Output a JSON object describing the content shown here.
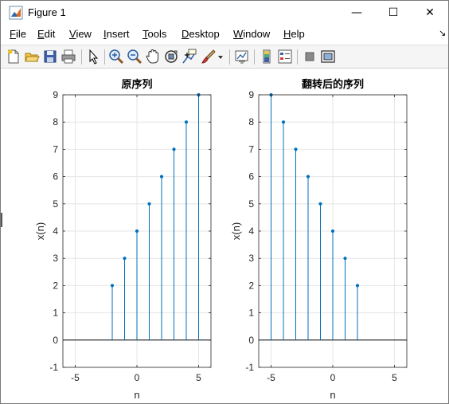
{
  "window": {
    "title": "Figure 1",
    "min_symbol": "—",
    "max_symbol": "☐",
    "close_symbol": "✕"
  },
  "menubar": {
    "items": [
      {
        "label": "File",
        "accel": "F",
        "rest": "ile"
      },
      {
        "label": "Edit",
        "accel": "E",
        "rest": "dit"
      },
      {
        "label": "View",
        "accel": "V",
        "rest": "iew"
      },
      {
        "label": "Insert",
        "accel": "I",
        "rest": "nsert"
      },
      {
        "label": "Tools",
        "accel": "T",
        "rest": "ools"
      },
      {
        "label": "Desktop",
        "accel": "D",
        "rest": "esktop"
      },
      {
        "label": "Window",
        "accel": "W",
        "rest": "indow"
      },
      {
        "label": "Help",
        "accel": "H",
        "rest": "elp"
      }
    ],
    "overflow_arrow": "↘"
  },
  "toolbar": {
    "icons": [
      "new-figure-icon",
      "open-file-icon",
      "save-icon",
      "print-icon",
      "edit-plot-arrow-icon",
      "zoom-in-icon",
      "zoom-out-icon",
      "pan-hand-icon",
      "rotate-3d-icon",
      "data-cursor-icon",
      "brush-icon",
      "brush-dropdown-icon",
      "link-plot-icon",
      "colorbar-icon",
      "legend-icon",
      "hide-plot-tools-icon",
      "show-plot-tools-icon"
    ]
  },
  "colors": {
    "stem": "#0072BD",
    "axis": "#262626",
    "grid": "#e6e6e6",
    "zero_line": "#000000"
  },
  "chart_data": [
    {
      "type": "stem",
      "title": "原序列",
      "xlabel": "n",
      "ylabel": "x(n)",
      "xlim": [
        -6,
        6
      ],
      "ylim": [
        -1,
        9
      ],
      "xticks": [
        -5,
        0,
        5
      ],
      "yticks": [
        -1,
        0,
        1,
        2,
        3,
        4,
        5,
        6,
        7,
        8,
        9
      ],
      "grid": true,
      "x": [
        -2,
        -1,
        0,
        1,
        2,
        3,
        4,
        5
      ],
      "y": [
        2,
        3,
        4,
        5,
        6,
        7,
        8,
        9
      ]
    },
    {
      "type": "stem",
      "title": "翻转后的序列",
      "xlabel": "n",
      "ylabel": "x(n)",
      "xlim": [
        -6,
        6
      ],
      "ylim": [
        -1,
        9
      ],
      "xticks": [
        -5,
        0,
        5
      ],
      "yticks": [
        -1,
        0,
        1,
        2,
        3,
        4,
        5,
        6,
        7,
        8,
        9
      ],
      "grid": true,
      "x": [
        -5,
        -4,
        -3,
        -2,
        -1,
        0,
        1,
        2
      ],
      "y": [
        9,
        8,
        7,
        6,
        5,
        4,
        3,
        2
      ]
    }
  ]
}
